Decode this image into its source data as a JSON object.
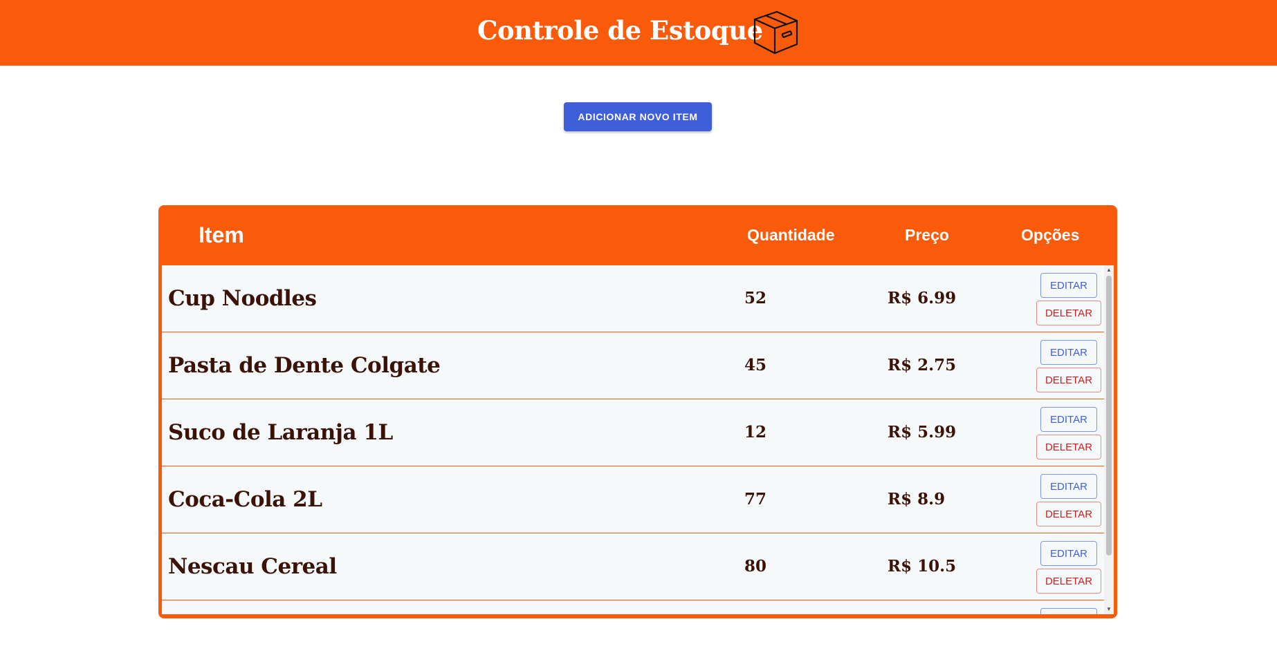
{
  "header": {
    "title": "Controle de Estoque",
    "icon": "box-icon",
    "background_color": "#f95b0b"
  },
  "actions": {
    "add_label": "ADICIONAR NOVO ITEM",
    "add_color": "#3f5fd9"
  },
  "table": {
    "columns": [
      "Item",
      "Quantidade",
      "Preço",
      "Opções"
    ],
    "edit_label": "EDITAR",
    "delete_label": "DELETAR",
    "rows": [
      {
        "name": "Cup Noodles",
        "quantity": "52",
        "price": "R$ 6.99"
      },
      {
        "name": "Pasta de Dente Colgate",
        "quantity": "45",
        "price": "R$ 2.75"
      },
      {
        "name": "Suco de Laranja 1L",
        "quantity": "12",
        "price": "R$ 5.99"
      },
      {
        "name": "Coca-Cola 2L",
        "quantity": "77",
        "price": "R$ 8.9"
      },
      {
        "name": "Nescau Cereal",
        "quantity": "80",
        "price": "R$ 10.5"
      }
    ]
  }
}
